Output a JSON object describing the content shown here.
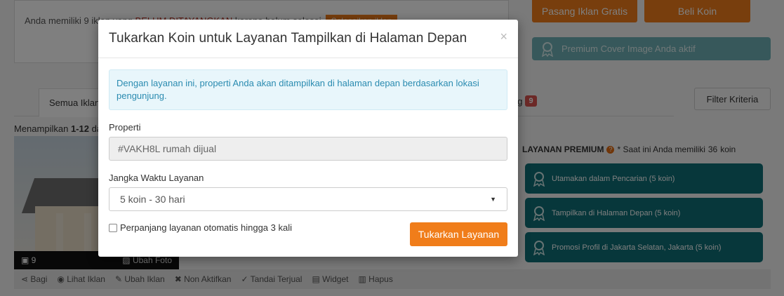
{
  "background": {
    "notice": {
      "text_prefix": "Anda memiliki 9 iklan yang ",
      "text_warning": "BELUM DITAYANGKAN",
      "text_suffix": " karena belum selesai",
      "button_label": "Selesaikan iklan"
    },
    "header_buttons": {
      "post_free_ad": "Pasang Iklan Gratis",
      "buy_coins": "Beli Koin"
    },
    "premium_cover_status": "Premium Cover Image Anda aktif",
    "tabs": {
      "all_ads": "Semua Iklan",
      "pending_suffix": "ng",
      "pending_count": "9"
    },
    "filter_button": "Filter Kriteria",
    "showing_prefix": "Menampilkan ",
    "showing_range": "1-12",
    "showing_suffix": " da",
    "listing": {
      "photo_count": "9",
      "change_photo": "Ubah Foto"
    },
    "actions": [
      "Bagi",
      "Lihat Iklan",
      "Ubah Iklan",
      "Non Aktifkan",
      "Tandai Terjual",
      "Widget",
      "Hapus"
    ],
    "premium": {
      "title": "LAYANAN PREMIUM",
      "note_prefix": "* Saat ini Anda memiliki",
      "coins": "36",
      "note_suffix": "koin",
      "services": [
        "Utamakan dalam Pencarian (5 koin)",
        "Tampilkan di Halaman Depan (5 koin)",
        "Promosi Profil di Jakarta Selatan, Jakarta (5 koin)"
      ]
    }
  },
  "modal": {
    "title": "Tukarkan Koin untuk Layanan Tampilkan di Halaman Depan",
    "close": "×",
    "info": "Dengan layanan ini, properti Anda akan ditampilkan di halaman depan berdasarkan lokasi pengunjung.",
    "property_label": "Properti",
    "property_value": "#VAKH8L rumah dijual",
    "duration_label": "Jangka Waktu Layanan",
    "duration_value": "5 koin - 30 hari",
    "auto_renew_label": "Perpanjang layanan otomatis hingga 3 kali",
    "submit_label": "Tukarkan Layanan"
  }
}
